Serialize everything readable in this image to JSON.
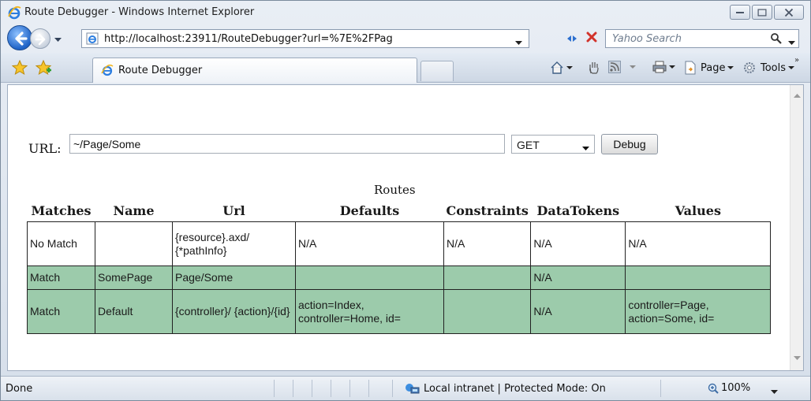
{
  "window": {
    "title": "Route Debugger - Windows Internet Explorer"
  },
  "addressbar": {
    "url": "http://localhost:23911/RouteDebugger?url=%7E%2FPag",
    "search_placeholder": "Yahoo Search"
  },
  "tabs": {
    "active_label": "Route Debugger"
  },
  "commandbar": {
    "page_label": "Page",
    "tools_label": "Tools"
  },
  "form": {
    "url_label": "URL:",
    "url_value": "~/Page/Some",
    "method_value": "GET",
    "debug_label": "Debug"
  },
  "routes": {
    "caption": "Routes",
    "headers": [
      "Matches",
      "Name",
      "Url",
      "Defaults",
      "Constraints",
      "DataTokens",
      "Values"
    ],
    "rows": [
      {
        "match": "No Match",
        "name": "",
        "url": "{resource}.axd/ {*pathInfo}",
        "defaults": "N/A",
        "constraints": "N/A",
        "datatokens": "N/A",
        "values": "N/A"
      },
      {
        "match": "Match",
        "name": "SomePage",
        "url": "Page/Some",
        "defaults": "",
        "constraints": "",
        "datatokens": "N/A",
        "values": ""
      },
      {
        "match": "Match",
        "name": "Default",
        "url": "{controller}/ {action}/{id}",
        "defaults": "action=Index, controller=Home, id=",
        "constraints": "",
        "datatokens": "N/A",
        "values": "controller=Page, action=Some, id="
      }
    ]
  },
  "status": {
    "text": "Done",
    "zone": "Local intranet | Protected Mode: On",
    "zoom": "100%"
  },
  "colors": {
    "match_row": "#9ccbab"
  }
}
